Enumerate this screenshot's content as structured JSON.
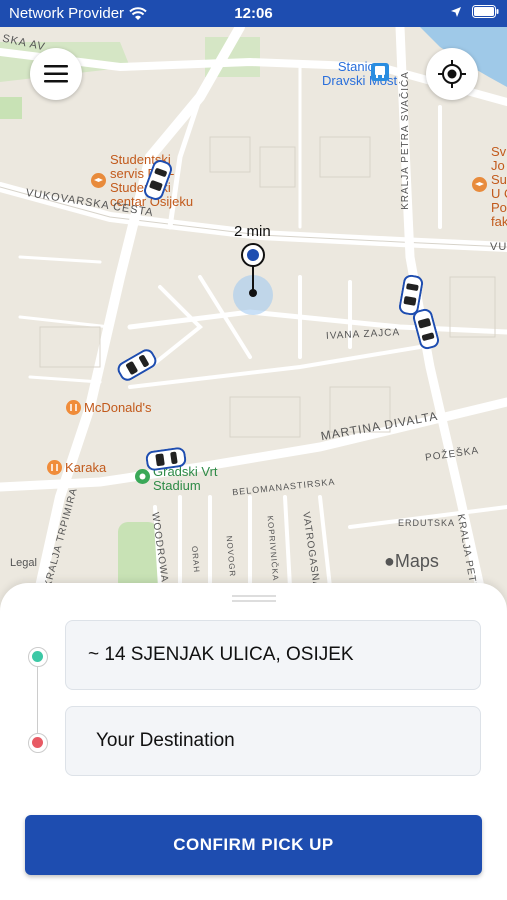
{
  "status": {
    "carrier": "Network Provider",
    "time": "12:06"
  },
  "map": {
    "eta": "2 min",
    "legal": "Legal",
    "maps_brand": "Maps",
    "labels": {
      "stanica1": "Stanica",
      "stanica2": "Dravski Most",
      "student1": "Studentski",
      "student2": "servis Pek-",
      "student3": "Studentski",
      "student4": "centar Osijeku",
      "mcdonalds": "McDonald's",
      "karaka": "Karaka",
      "gradski1": "Gradski Vrt",
      "gradski2": "Stadium",
      "right1": "Sv",
      "right2": "Jo",
      "right3": "Su",
      "right4": "U O",
      "right5": "Po",
      "right6": "fak"
    },
    "streets": {
      "vukovarska": "VUKOVARSKA CESTA",
      "vu_right": "VU",
      "ivana_zajca": "IVANA ZAJCA",
      "martina_divalta": "MARTINA DIVALTA",
      "pozeska": "POŽEŠKA",
      "belomanastirska": "BELOMANASTIRSKA",
      "erdutska": "ERDUTSKA",
      "kralja_petra_top": "KRALJA PETRA SVAČIĆA",
      "kralja_petra_bottom": "KRALJA PETR",
      "woodrowa": "WOODROWA",
      "vatrogasna": "VATROGASNA",
      "koprivnicka": "KOPRIVNIČKA",
      "novogradiska": "NOVOGR",
      "orahovacka": "ORAH",
      "trpimira": "KRALJA TRPIMIRA",
      "top_left": "SKA AV"
    }
  },
  "pickup": {
    "value": "~ 14 SJENJAK ULICA, OSIJEK"
  },
  "destination": {
    "placeholder": "Your Destination"
  },
  "confirm_label": "CONFIRM PICK UP",
  "colors": {
    "brand": "#1e4db0",
    "pickup_dot": "#3cc8a5",
    "dest_dot": "#e85a64"
  }
}
